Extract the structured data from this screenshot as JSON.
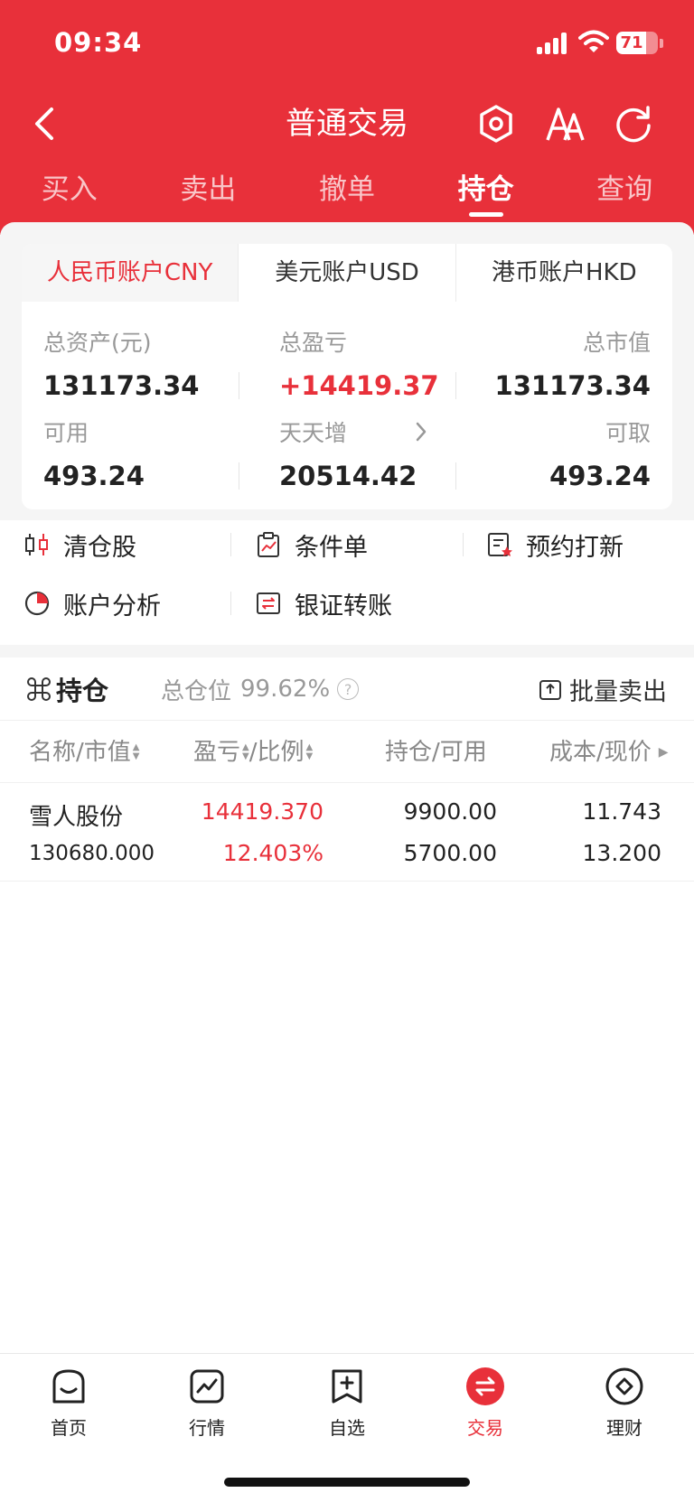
{
  "status_bar": {
    "time": "09:34",
    "battery": "71"
  },
  "nav": {
    "title": "普通交易"
  },
  "top_tabs": [
    {
      "label": "买入"
    },
    {
      "label": "卖出"
    },
    {
      "label": "撤单"
    },
    {
      "label": "持仓",
      "active": true
    },
    {
      "label": "查询"
    }
  ],
  "account_tabs": [
    {
      "label": "人民币账户CNY",
      "active": true
    },
    {
      "label": "美元账户USD"
    },
    {
      "label": "港币账户HKD"
    }
  ],
  "summary": {
    "total_assets_label": "总资产(元)",
    "total_assets": "131173.34",
    "total_pnl_label": "总盈亏",
    "total_pnl": "+14419.37",
    "market_value_label": "总市值",
    "market_value": "131173.34",
    "available_label": "可用",
    "available": "493.24",
    "tiantianzeng_label": "天天增",
    "tiantianzeng": "20514.42",
    "withdrawable_label": "可取",
    "withdrawable": "493.24"
  },
  "quick_actions": [
    {
      "label": "清仓股"
    },
    {
      "label": "条件单"
    },
    {
      "label": "预约打新"
    },
    {
      "label": "账户分析"
    },
    {
      "label": "银证转账"
    }
  ],
  "positions": {
    "title": "持仓",
    "ratio_label": "总仓位",
    "ratio": "99.62%",
    "batch_sell": "批量卖出",
    "columns": {
      "name": "名称/市值",
      "pnl": "盈亏",
      "pnl_ratio": "/比例",
      "holding": "持仓/可用",
      "cost": "成本/现价"
    },
    "rows": [
      {
        "name": "雪人股份",
        "market_value": "130680.000",
        "pnl": "14419.370",
        "pnl_ratio": "12.403%",
        "holding": "9900.00",
        "available": "5700.00",
        "cost": "11.743",
        "price": "13.200"
      }
    ]
  },
  "tabbar": [
    {
      "label": "首页"
    },
    {
      "label": "行情"
    },
    {
      "label": "自选"
    },
    {
      "label": "交易",
      "active": true
    },
    {
      "label": "理财"
    }
  ],
  "colors": {
    "brand": "#e8303a",
    "text": "#222222",
    "muted": "#999999"
  }
}
